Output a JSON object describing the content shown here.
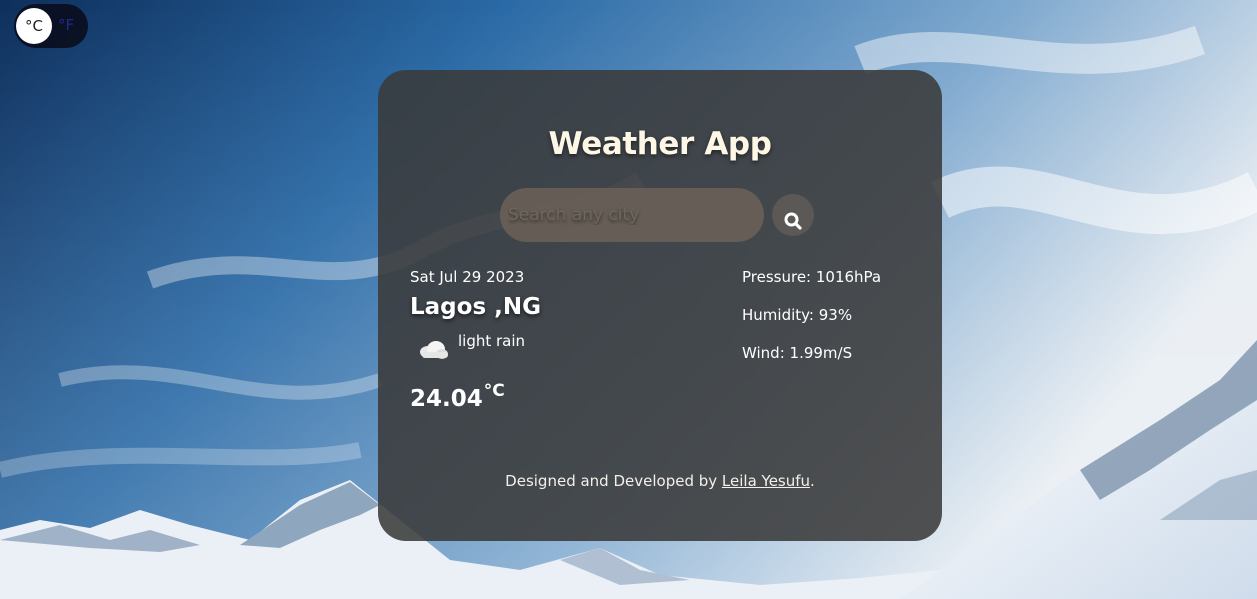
{
  "unit_toggle": {
    "active_unit": "°C",
    "alt_unit": "°F"
  },
  "app": {
    "title": "Weather App"
  },
  "search": {
    "placeholder": "Search any city",
    "button_icon": "search-icon"
  },
  "current": {
    "date": "Sat Jul 29 2023",
    "city": "Lagos ,NG",
    "icon": "cloud-rain-icon",
    "description": "light rain",
    "temperature": "24.04",
    "temperature_unit": "°C"
  },
  "stats": {
    "pressure": "Pressure: 1016hPa",
    "humidity": "Humidity: 93%",
    "wind": "Wind: 1.99m/S"
  },
  "footer": {
    "prefix": "Designed and Developed by ",
    "author_link": "Leila Yesufu",
    "suffix": "."
  },
  "colors": {
    "card_bg": "#3a3a3a",
    "title": "#fff7e6",
    "sky": "#2b5f94",
    "snow": "#eef3f8"
  }
}
